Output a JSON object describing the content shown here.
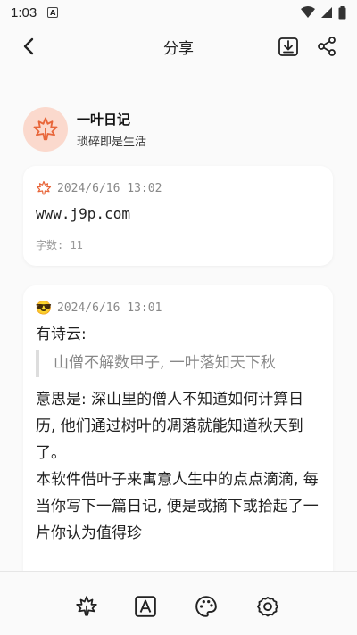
{
  "status": {
    "time": "1:03",
    "notif_glyph": "A"
  },
  "appbar": {
    "title": "分享"
  },
  "profile": {
    "name": "一叶日记",
    "slogan": "琐碎即是生活"
  },
  "entries": [
    {
      "date": "2024/6/16 13:02",
      "text": "www.j9p.com",
      "count": "字数: 11"
    },
    {
      "date": "2024/6/16 13:01",
      "emoji": "😎",
      "intro": "有诗云:",
      "quote": "山僧不解数甲子, 一叶落知天下秋",
      "p1": "意思是: 深山里的僧人不知道如何计算日历, 他们通过树叶的凋落就能知道秋天到了。",
      "p2": "本软件借叶子来寓意人生中的点点滴滴, 每当你写下一篇日记, 便是或摘下或拾起了一片你认为值得珍"
    }
  ],
  "colors": {
    "accent": "#e8663a",
    "avatar_bg": "#fbd9cd"
  }
}
